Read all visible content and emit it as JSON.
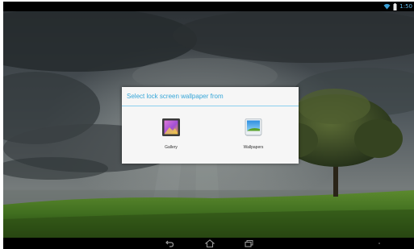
{
  "dialog": {
    "title": "Select lock screen wallpaper from",
    "options": [
      {
        "label": "Gallery",
        "icon": "gallery-icon"
      },
      {
        "label": "Wallpapers",
        "icon": "wallpapers-icon"
      }
    ]
  },
  "status_bar": {
    "time": "1:50",
    "icons": [
      "wifi-icon",
      "battery-icon"
    ]
  },
  "nav_bar": {
    "buttons": [
      "back-icon",
      "home-icon",
      "recent-apps-icon"
    ]
  },
  "colors": {
    "accent": "#36a6d8",
    "dialog_bg": "#f6f6f6"
  }
}
